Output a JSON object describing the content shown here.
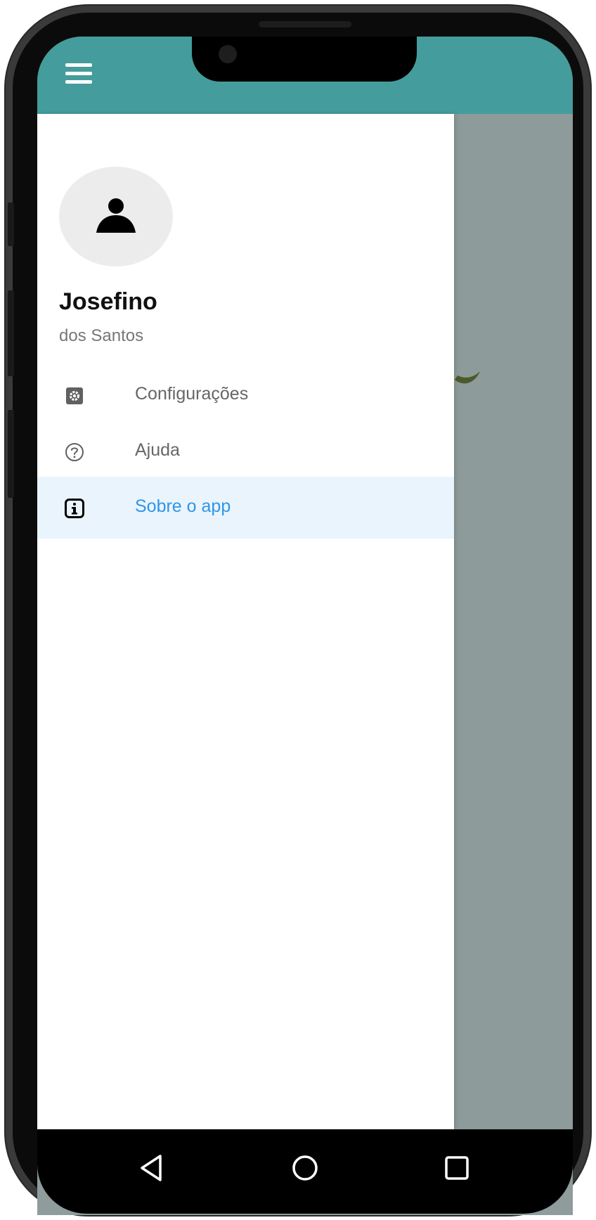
{
  "app_bar": {
    "menu_icon": "hamburger-menu-icon",
    "color": "#459c9c"
  },
  "drawer": {
    "avatar_icon": "user-silhouette-icon",
    "user_first_name": "Josefino",
    "user_last_name": "dos Santos",
    "items": [
      {
        "label": "Configurações",
        "icon": "settings-gear-icon",
        "active": false
      },
      {
        "label": "Ajuda",
        "icon": "help-circle-icon",
        "active": false
      },
      {
        "label": "Sobre o app",
        "icon": "info-icon",
        "active": true
      }
    ],
    "active_color": "#2f96e8",
    "active_background": "#eaf4fc"
  },
  "system_nav": {
    "back_icon": "back-triangle-icon",
    "home_icon": "home-circle-icon",
    "recents_icon": "recents-square-icon"
  }
}
